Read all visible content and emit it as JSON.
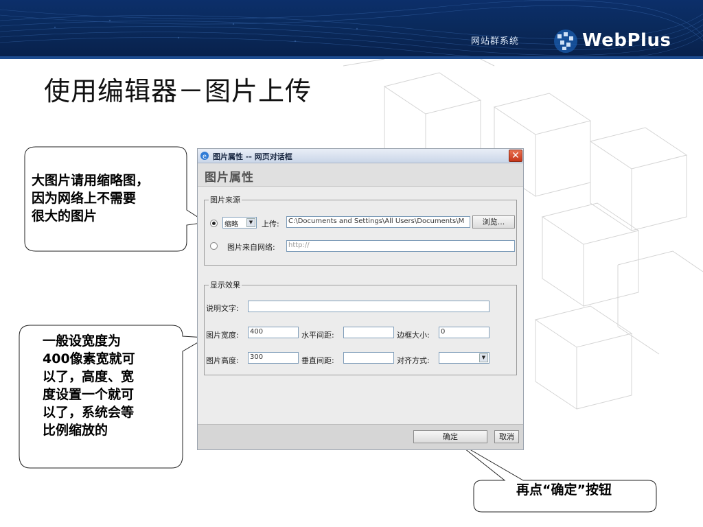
{
  "banner": {
    "subtitle": "网站群系统",
    "brand": "WebPlus"
  },
  "slide": {
    "title": "使用编辑器－图片上传"
  },
  "dialog": {
    "window_title": "图片属性 -- 网页对话框",
    "header": "图片属性",
    "source_group": {
      "legend": "图片来源",
      "mode_selected": "缩略",
      "upload_label": "上传:",
      "upload_path": "C:\\Documents and Settings\\All Users\\Documents\\M",
      "browse_label": "浏览...",
      "network_label": "图片来自网络:",
      "network_placeholder": "http://"
    },
    "display_group": {
      "legend": "显示效果",
      "caption_label": "说明文字:",
      "caption_value": "",
      "width_label": "图片宽度:",
      "width_value": "400",
      "hspace_label": "水平间距:",
      "hspace_value": "",
      "border_label": "边框大小:",
      "border_value": "0",
      "height_label": "图片高度:",
      "height_value": "300",
      "vspace_label": "垂直间距:",
      "vspace_value": "",
      "align_label": "对齐方式:",
      "align_value": ""
    },
    "ok_label": "确定",
    "cancel_label": "取消"
  },
  "callouts": {
    "thumbnail_line1": "大图片请用缩略图，",
    "thumbnail_line2": "因为网络上不需要",
    "thumbnail_line3": "很大的图片",
    "size_line1": "一般设宽度为",
    "size_line2": "400像素宽就可",
    "size_line3": "以了，高度、宽",
    "size_line4": "度设置一个就可",
    "size_line5": "以了，系统会等",
    "size_line6": "比例缩放的",
    "confirm": "再点“确定”按钮"
  }
}
